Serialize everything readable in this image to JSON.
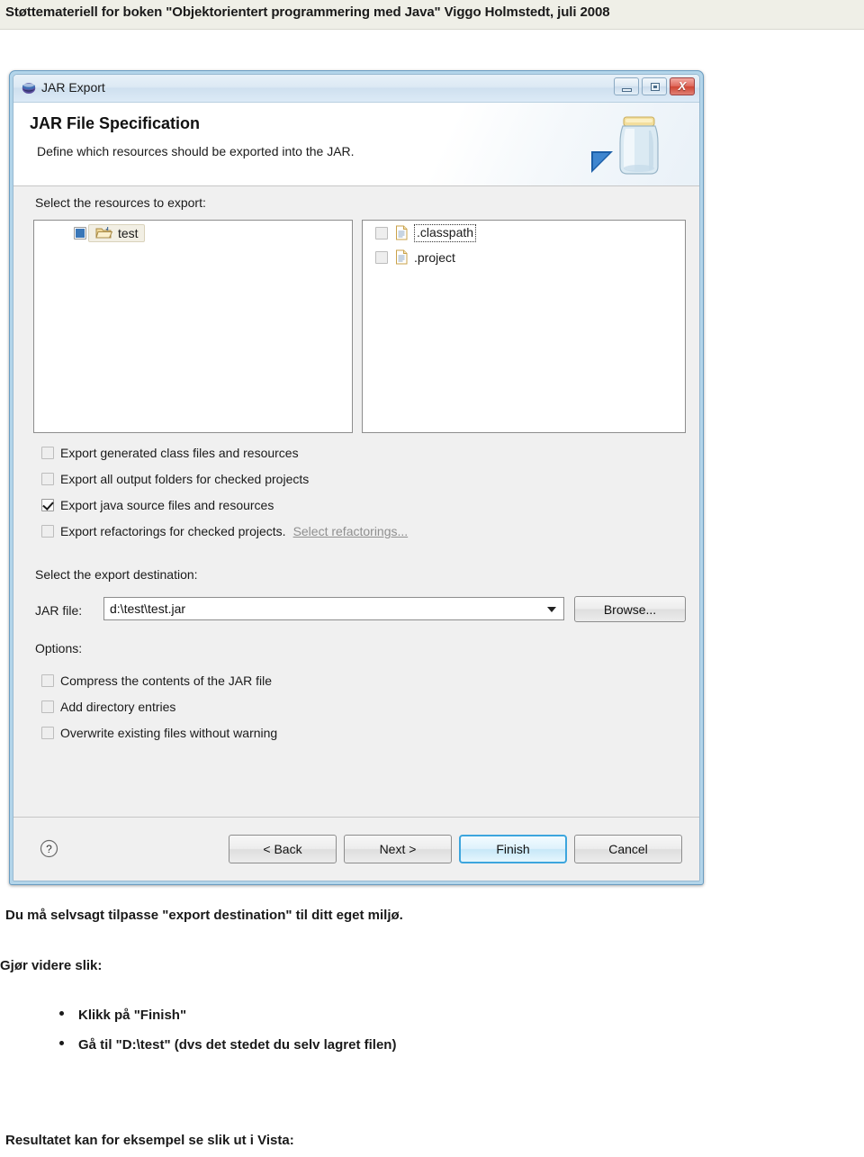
{
  "page_header": {
    "text": "Støttemateriell for boken \"Objektorientert programmering med Java\"  Viggo Holmstedt, juli 2008"
  },
  "dialog": {
    "titlebar": {
      "icon": "eclipse-sphere-icon",
      "title": "JAR Export",
      "buttons": {
        "minimize": "minimize-icon",
        "maximize": "maximize-icon",
        "close": "X"
      }
    },
    "header": {
      "title": "JAR File Specification",
      "subtitle": "Define which resources should be exported into the JAR.",
      "banner_icon": "jar-jar-icon",
      "arrow_icon": "blue-arrow-icon"
    },
    "resources": {
      "label": "Select the resources to export:",
      "label_mnemonic": "e",
      "left_tree": [
        {
          "name": "test",
          "checkbox": "partial",
          "icon": "open-folder-icon",
          "selected": true
        }
      ],
      "right_tree": [
        {
          "name": ".classpath",
          "checkbox": "unchecked",
          "icon": "file-icon",
          "focused": true
        },
        {
          "name": ".project",
          "checkbox": "unchecked",
          "icon": "file-icon",
          "focused": false
        }
      ]
    },
    "export_options": [
      {
        "label": "Export generated class files and resources",
        "checked": false
      },
      {
        "label": "Export all output folders for checked projects",
        "checked": false
      },
      {
        "label": "Export java source files and resources",
        "checked": true
      },
      {
        "label": "Export refactorings for checked projects.",
        "checked": false,
        "link": "Select refactorings..."
      }
    ],
    "destination": {
      "label": "Select the export destination:",
      "field_label": "JAR file:",
      "value": "d:\\test\\test.jar",
      "placeholder": "",
      "browse_label": "Browse..."
    },
    "options": {
      "label": "Options:",
      "items": [
        {
          "label": "Compress the contents of the JAR file",
          "checked": false
        },
        {
          "label": "Add directory entries",
          "checked": false
        },
        {
          "label": "Overwrite existing files without warning",
          "checked": false
        }
      ]
    },
    "footer": {
      "help_icon": "question-mark-icon",
      "buttons": [
        {
          "label": "< Back",
          "primary": false
        },
        {
          "label": "Next >",
          "primary": false
        },
        {
          "label": "Finish",
          "primary": true
        },
        {
          "label": "Cancel",
          "primary": false
        }
      ]
    }
  },
  "body_text": {
    "paragraph1": "Du må selvsagt tilpasse \"export destination\" til ditt eget miljø.",
    "paragraph2": "Gjør videre slik:",
    "bullets": [
      "Klikk på \"Finish\"",
      "Gå til \"D:\\test\" (dvs det stedet du selv lagret filen)"
    ],
    "paragraph3": "Resultatet kan for eksempel se slik ut i Vista:"
  },
  "colors": {
    "accent": "#3ca5dd",
    "header_band": "#efefe7",
    "dialog_frame": "#b3d5ea",
    "dialog_bg": "#f0f0f0"
  }
}
